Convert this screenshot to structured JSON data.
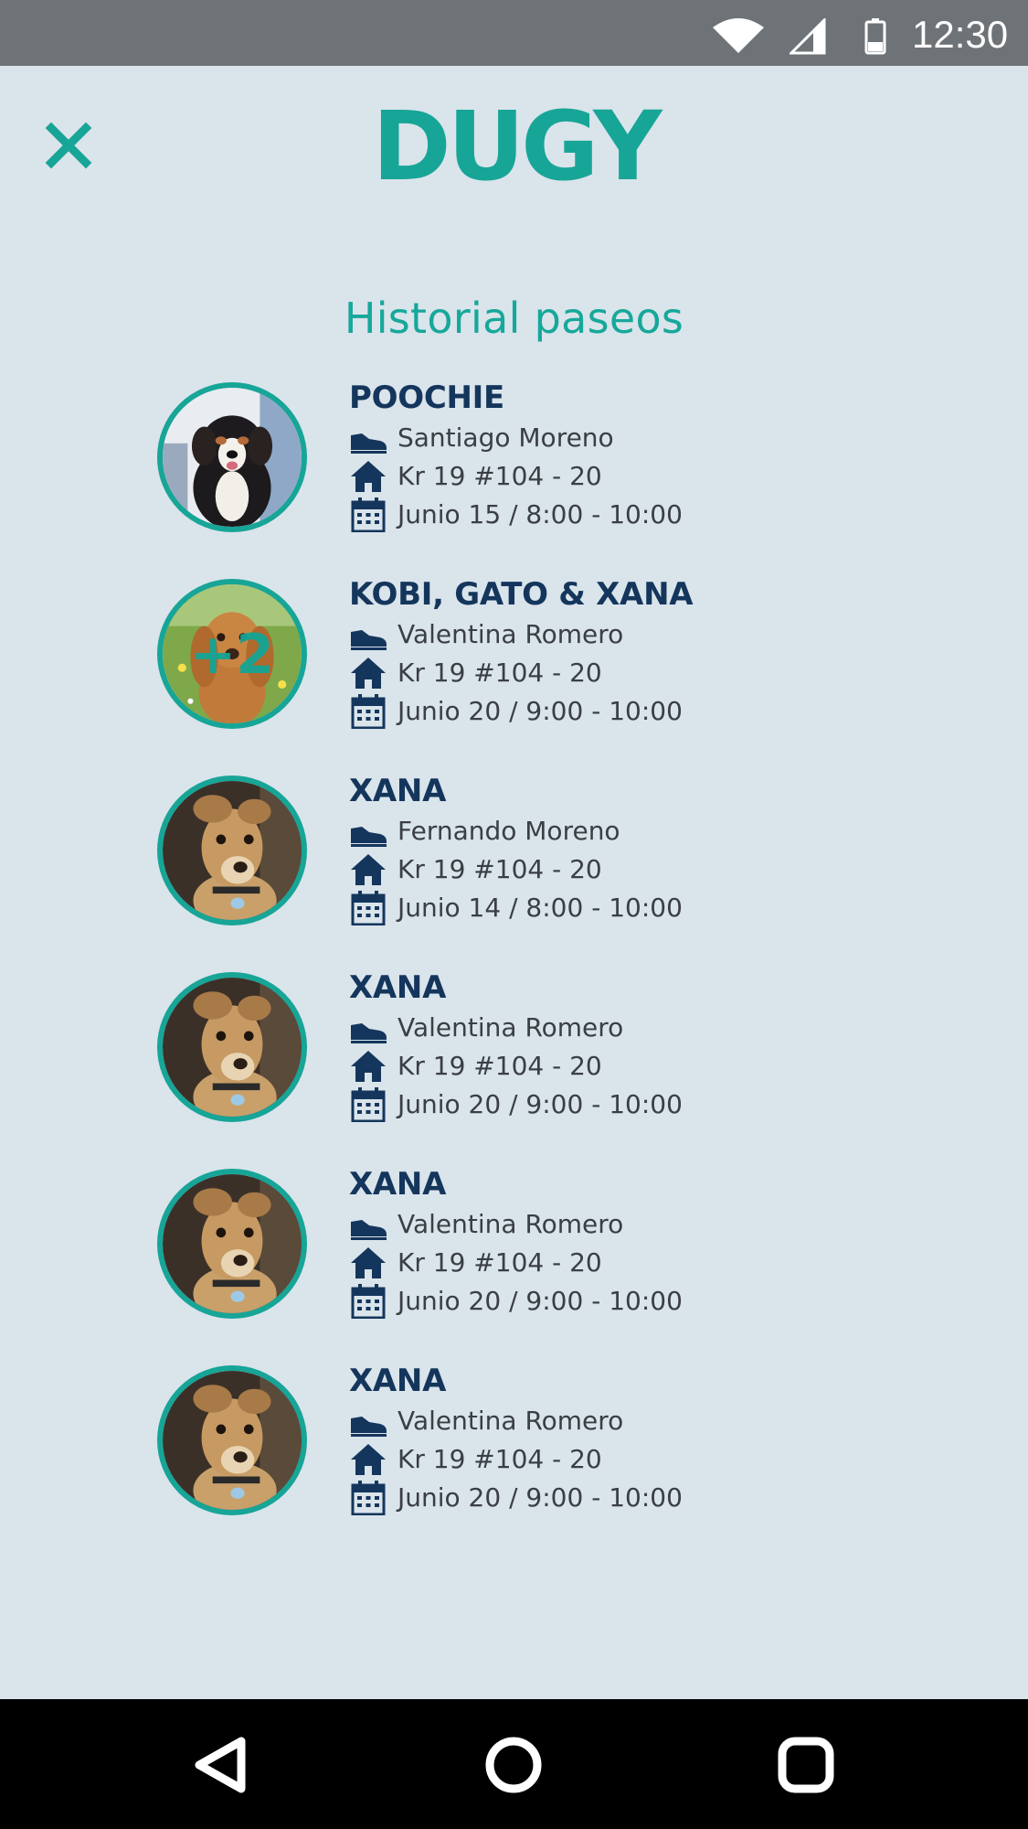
{
  "status_bar": {
    "time": "12:30",
    "icons": [
      "wifi-icon",
      "signal-icon",
      "battery-icon"
    ]
  },
  "header": {
    "logo_text": "DUGY",
    "close_icon": "close-icon",
    "title": "Historial paseos"
  },
  "colors": {
    "accent": "#17a597",
    "name": "#14365c",
    "background": "#dae4eb",
    "text": "#3a3f44"
  },
  "walks": [
    {
      "name": "POOCHIE",
      "walker": "Santiago Moreno",
      "address": "Kr 19 #104 - 20",
      "schedule": "Junio 15 / 8:00 - 10:00",
      "photo": "bernese-puppy",
      "badge": ""
    },
    {
      "name": "KOBI, GATO & XANA",
      "walker": "Valentina Romero",
      "address": "Kr 19 #104 - 20",
      "schedule": "Junio 20 / 9:00 - 10:00",
      "photo": "spaniel",
      "badge": "+2"
    },
    {
      "name": "XANA",
      "walker": "Fernando Moreno",
      "address": "Kr 19 #104 - 20",
      "schedule": "Junio 14 / 8:00 - 10:00",
      "photo": "greyhound",
      "badge": ""
    },
    {
      "name": "XANA",
      "walker": "Valentina Romero",
      "address": "Kr 19 #104 - 20",
      "schedule": "Junio 20 / 9:00 - 10:00",
      "photo": "greyhound",
      "badge": ""
    },
    {
      "name": "XANA",
      "walker": "Valentina Romero",
      "address": "Kr 19 #104 - 20",
      "schedule": "Junio 20 / 9:00 - 10:00",
      "photo": "greyhound",
      "badge": ""
    },
    {
      "name": "XANA",
      "walker": "Valentina Romero",
      "address": "Kr 19 #104 - 20",
      "schedule": "Junio 20 / 9:00 - 10:00",
      "photo": "greyhound",
      "badge": ""
    }
  ],
  "row_icons": {
    "walker": "shoe-icon",
    "address": "home-icon",
    "schedule": "calendar-icon"
  },
  "nav_bar": {
    "icons": [
      "back-icon",
      "home-circle-icon",
      "recents-icon"
    ]
  }
}
